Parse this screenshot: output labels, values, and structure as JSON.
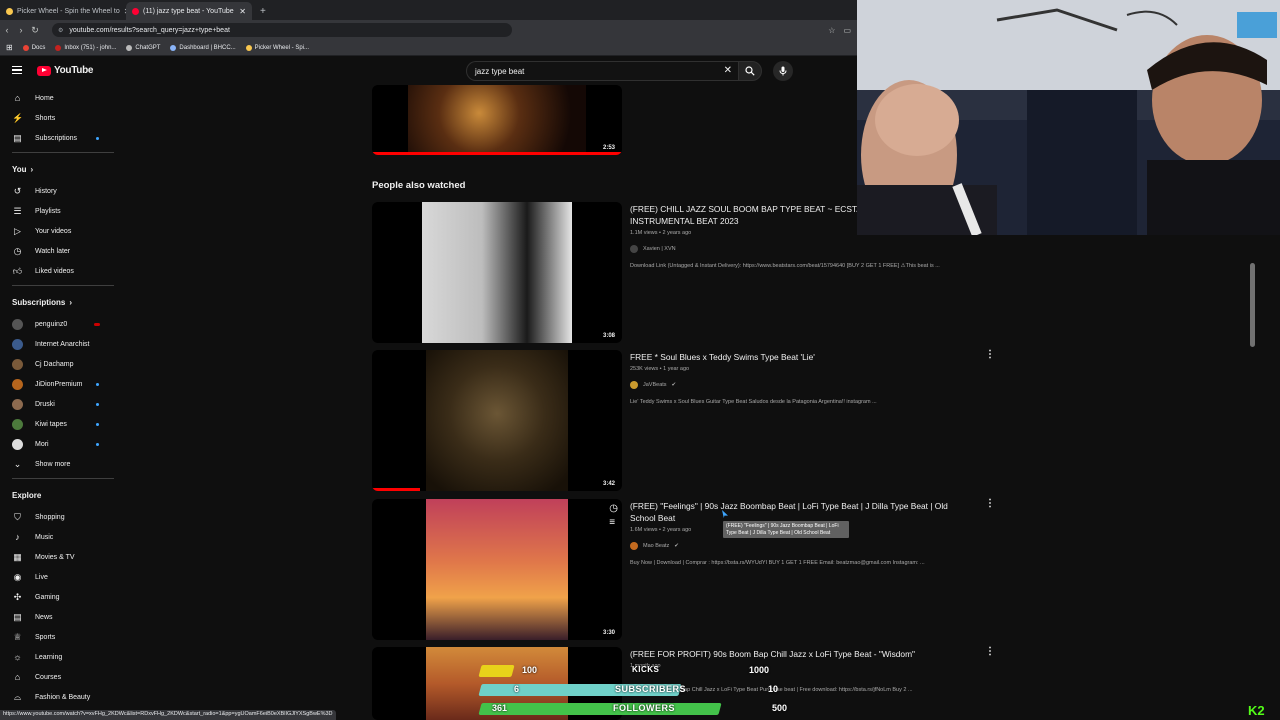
{
  "browser": {
    "tabs": [
      {
        "label": "Picker Wheel - Spin the Wheel to",
        "active": false
      },
      {
        "label": "(11) jazz type beat - YouTube",
        "active": true
      }
    ],
    "url": "youtube.com/results?search_query=jazz+type+beat",
    "bookmarks": [
      "Docs",
      "Inbox (751) - john...",
      "ChatGPT",
      "Dashboard | BHCC...",
      "Picker Wheel - Spi..."
    ],
    "status_url": "https://www.youtube.com/watch?v=xvFHg_2KDWc&list=RDxvFHg_2KDWc&start_radio=1&pp=ygUOamF6eiB0eXBlIGJlYXSgBwE%3D"
  },
  "youtube": {
    "logo_text": "YouTube",
    "search_value": "jazz type beat",
    "sidebar": {
      "main": [
        "Home",
        "Shorts",
        "Subscriptions"
      ],
      "you_heading": "You",
      "you": [
        "History",
        "Playlists",
        "Your videos",
        "Watch later",
        "Liked videos"
      ],
      "subs_heading": "Subscriptions",
      "subs": [
        "penguinz0",
        "Internet Anarchist",
        "Cj Dachamp",
        "JiDionPremium",
        "Druski",
        "Kiwi tapes",
        "Mori",
        "Show more"
      ],
      "explore_heading": "Explore",
      "explore": [
        "Shopping",
        "Music",
        "Movies & TV",
        "Live",
        "Gaming",
        "News",
        "Sports",
        "Learning",
        "Courses",
        "Fashion & Beauty"
      ]
    },
    "first_duration": "2:53",
    "people_also_watched": "People also watched",
    "videos": [
      {
        "title": "(FREE) CHILL JAZZ SOUL BOOM BAP TYPE BEAT ~ ECSTASY | JAZZ HIP HOP INSTRUMENTAL BEAT 2023",
        "meta": "1.1M views • 2 years ago",
        "channel": "Xavien | XVN",
        "desc": "Download Link (Untagged & Instant Delivery): https://www.beatstars.com/beat/15794640 [BUY 2 GET 1 FREE] ⚠This beat is ...",
        "duration": "3:08"
      },
      {
        "title": "FREE * Soul Blues x Teddy Swims Type Beat 'Lie'",
        "meta": "253K views • 1 year ago",
        "channel": "JaVBeats",
        "desc": "Lie' Teddy Swims x Soul Blues Guitar Type Beat Saludos desde la Patagonia Argentina!! instagram ...",
        "duration": "3:42"
      },
      {
        "title": "(FREE) \"Feelings\" | 90s Jazz Boombap Beat | LoFi Type Beat | J Dilla Type Beat | Old School Beat",
        "meta": "1.6M views • 2 years ago",
        "channel": "Mao Beatz",
        "desc": "Buy Now | Download | Comprar : https://bsta.rs/WYUdYI BUY 1 GET 1 FREE Email: beatzmao@gmail.com Instagram: ...",
        "duration": "3:30"
      },
      {
        "title": "(FREE FOR PROFIT) 90s Boom Bap Chill Jazz x LoFi Type Beat - \"Wisdom\"",
        "meta": "1 month ago",
        "channel": "",
        "desc": "Wisdom - 90s boom Bap Chill Jazz x LoFi Type Beat Purchase beat | Free download: https://bsta.rs/jfNoLm Buy 2 ...",
        "duration": ""
      }
    ],
    "tooltip": "(FREE) \"Feelings\" | 90s Jazz Boombap Beat | LoFi Type Beat | J Dilla Type Beat | Old School Beat"
  },
  "overlay": {
    "kicks": {
      "label": "KICKS",
      "current": "100",
      "goal": "1000"
    },
    "subscribers": {
      "label": "SUBSCRIBERS",
      "current": "6",
      "goal": "10"
    },
    "followers": {
      "label": "FOLLOWERS",
      "current": "361",
      "goal": "500"
    },
    "corner": "K2"
  },
  "colors": {
    "yt_red": "#ff0033",
    "bg": "#0f0f0f",
    "kick_green": "#53fc18"
  }
}
